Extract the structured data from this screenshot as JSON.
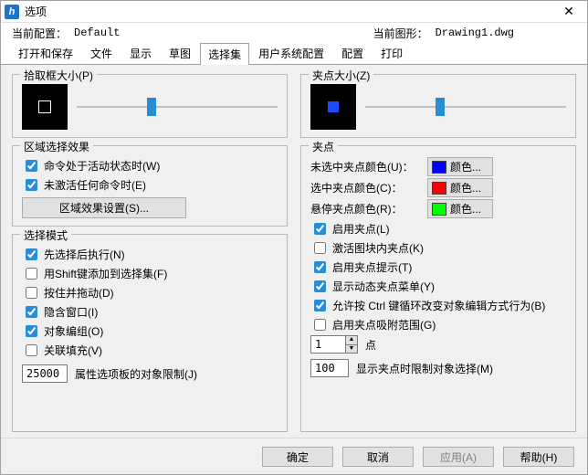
{
  "window": {
    "title": "选项"
  },
  "info": {
    "config_label": "当前配置：",
    "config_value": "Default",
    "drawing_label": "当前图形：",
    "drawing_value": "Drawing1.dwg"
  },
  "tabs": {
    "open_save": "打开和保存",
    "files": "文件",
    "display": "显示",
    "drafting": "草图",
    "selection": "选择集",
    "user_prefs": "用户系统配置",
    "profiles": "配置",
    "print": "打印"
  },
  "left": {
    "pickbox": {
      "legend": "拾取框大小(P)"
    },
    "region": {
      "legend": "区域选择效果",
      "chk_active": "命令处于活动状态时(W)",
      "chk_not_active": "未激活任何命令时(E)",
      "btn_settings": "区域效果设置(S)..."
    },
    "mode": {
      "legend": "选择模式",
      "chk_noun_verb": "先选择后执行(N)",
      "chk_shift_add": "用Shift键添加到选择集(F)",
      "chk_press_drag": "按住并拖动(D)",
      "chk_implied": "隐含窗口(I)",
      "chk_groups": "对象编组(O)",
      "chk_hatch": "关联填充(V)",
      "limit_value": "25000",
      "limit_label": "属性选项板的对象限制(J)"
    }
  },
  "right": {
    "gripsize": {
      "legend": "夹点大小(Z)"
    },
    "grips": {
      "legend": "夹点",
      "lbl_unsel": "未选中夹点颜色(U)：",
      "lbl_sel": "选中夹点颜色(C)：",
      "lbl_hover": "悬停夹点颜色(R)：",
      "color_btn": "颜色...",
      "chk_enable": "启用夹点(L)",
      "chk_blocks": "激活图块内夹点(K)",
      "chk_tips": "启用夹点提示(T)",
      "chk_dynmenu": "显示动态夹点菜单(Y)",
      "chk_ctrlcycle": "允许按 Ctrl 键循环改变对象编辑方式行为(B)",
      "chk_snaprange": "启用夹点吸附范围(G)",
      "spin_value": "1",
      "spin_label": "点",
      "limit_value": "100",
      "limit_label": "显示夹点时限制对象选择(M)"
    }
  },
  "footer": {
    "ok": "确定",
    "cancel": "取消",
    "apply": "应用(A)",
    "help": "帮助(H)"
  }
}
